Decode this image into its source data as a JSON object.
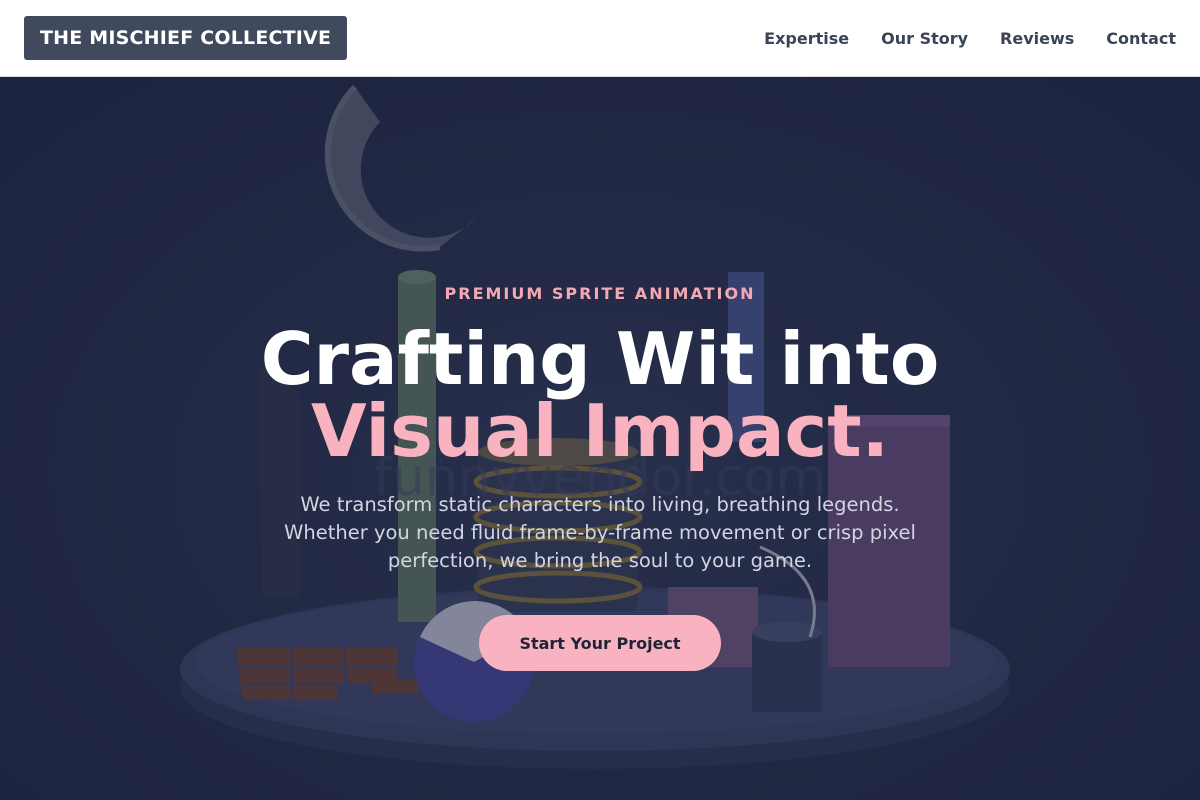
{
  "header": {
    "logo": "THE MISCHIEF COLLECTIVE",
    "nav": [
      "Expertise",
      "Our Story",
      "Reviews",
      "Contact"
    ]
  },
  "hero": {
    "eyebrow": "PREMIUM SPRITE ANIMATION",
    "headline_line1": "Crafting Wit into",
    "headline_line2": "Visual Impact.",
    "subtitle": "We transform static characters into living, breathing legends. Whether you need fluid frame-by-frame movement or crisp pixel perfection, we bring the soul to your game.",
    "cta": "Start Your Project"
  },
  "colors": {
    "header_bg": "#ffffff",
    "logo_bg": "#414a5c",
    "hero_bg": "#232a44",
    "accent_pink": "#f9b3c0",
    "nav_text": "#3b4456"
  }
}
